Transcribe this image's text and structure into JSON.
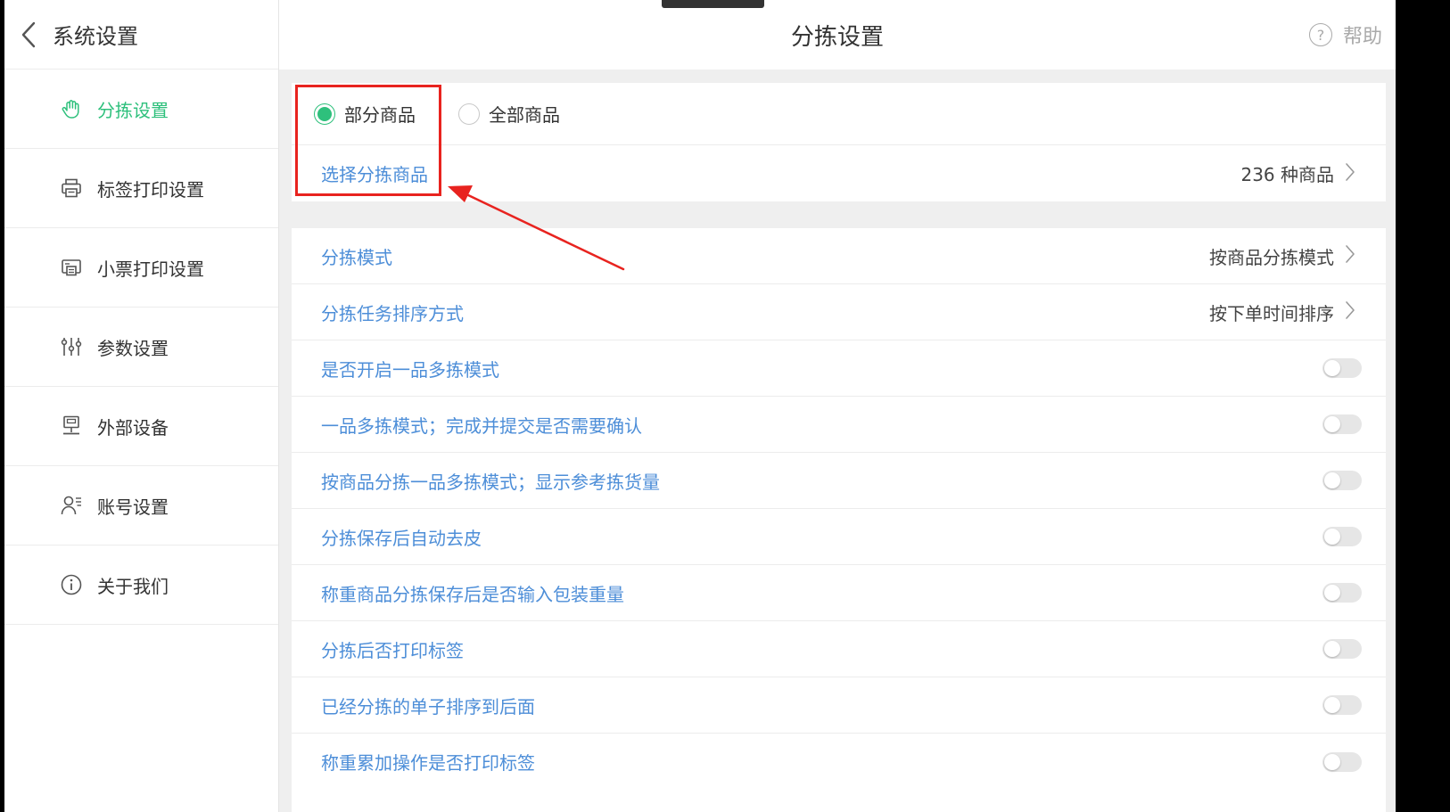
{
  "sidebar": {
    "title": "系统设置",
    "items": [
      {
        "label": "分拣设置",
        "icon": "hand-icon",
        "active": true
      },
      {
        "label": "标签打印设置",
        "icon": "printer-icon",
        "active": false
      },
      {
        "label": "小票打印设置",
        "icon": "receipt-printer-icon",
        "active": false
      },
      {
        "label": "参数设置",
        "icon": "sliders-icon",
        "active": false
      },
      {
        "label": "外部设备",
        "icon": "scale-icon",
        "active": false
      },
      {
        "label": "账号设置",
        "icon": "user-list-icon",
        "active": false
      },
      {
        "label": "关于我们",
        "icon": "info-icon",
        "active": false
      }
    ]
  },
  "header": {
    "title": "分拣设置",
    "help_label": "帮助",
    "help_glyph": "?"
  },
  "scope": {
    "options": [
      {
        "label": "部分商品",
        "selected": true
      },
      {
        "label": "全部商品",
        "selected": false
      }
    ],
    "select_label": "选择分拣商品",
    "select_value": "236 种商品"
  },
  "settings": [
    {
      "label": "分拣模式",
      "value": "按商品分拣模式",
      "type": "link"
    },
    {
      "label": "分拣任务排序方式",
      "value": "按下单时间排序",
      "type": "link"
    },
    {
      "label": "是否开启一品多拣模式",
      "type": "toggle",
      "on": false
    },
    {
      "label": "一品多拣模式；完成并提交是否需要确认",
      "type": "toggle",
      "on": false
    },
    {
      "label": "按商品分拣一品多拣模式；显示参考拣货量",
      "type": "toggle",
      "on": false
    },
    {
      "label": "分拣保存后自动去皮",
      "type": "toggle",
      "on": false
    },
    {
      "label": "称重商品分拣保存后是否输入包装重量",
      "type": "toggle",
      "on": false
    },
    {
      "label": "分拣后否打印标签",
      "type": "toggle",
      "on": false
    },
    {
      "label": "已经分拣的单子排序到后面",
      "type": "toggle",
      "on": false
    },
    {
      "label": "称重累加操作是否打印标签",
      "type": "toggle",
      "on": false
    }
  ],
  "colors": {
    "accent_green": "#2ec07c",
    "link_blue": "#4d8ed8",
    "annotation_red": "#e8231f"
  }
}
